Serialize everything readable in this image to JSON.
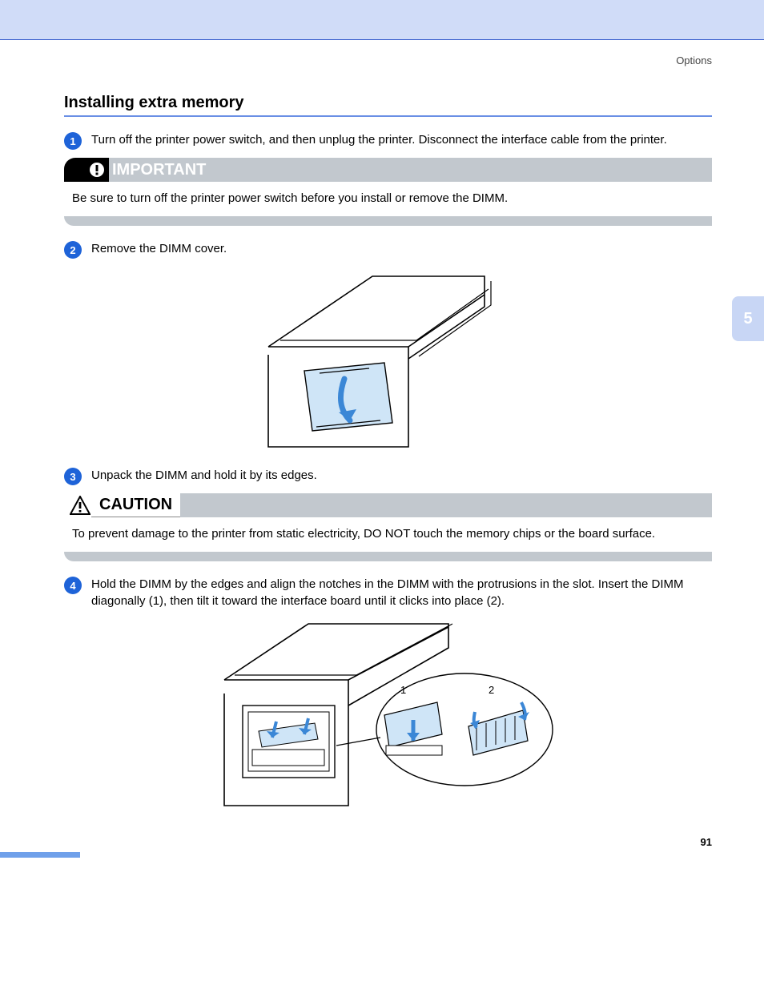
{
  "header": {
    "chapter_label": "Options"
  },
  "side_tab": "5",
  "page_number": "91",
  "section": {
    "title": "Installing extra memory"
  },
  "steps": {
    "s1": {
      "num": "1",
      "text": "Turn off the printer power switch, and then unplug the printer. Disconnect the interface cable from the printer."
    },
    "s2": {
      "num": "2",
      "text": "Remove the DIMM cover."
    },
    "s3": {
      "num": "3",
      "text": "Unpack the DIMM and hold it by its edges."
    },
    "s4": {
      "num": "4",
      "text": "Hold the DIMM by the edges and align the notches in the DIMM with the protrusions in the slot. Insert the DIMM diagonally (1), then tilt it toward the interface board until it clicks into place (2)."
    }
  },
  "notices": {
    "important": {
      "title": "IMPORTANT",
      "body": "Be sure to turn off the printer power switch before you install or remove the DIMM."
    },
    "caution": {
      "title": "CAUTION",
      "body": "To prevent damage to the printer from static electricity, DO NOT touch the memory chips or the board surface."
    }
  },
  "figure2": {
    "label1": "1",
    "label2": "2"
  }
}
